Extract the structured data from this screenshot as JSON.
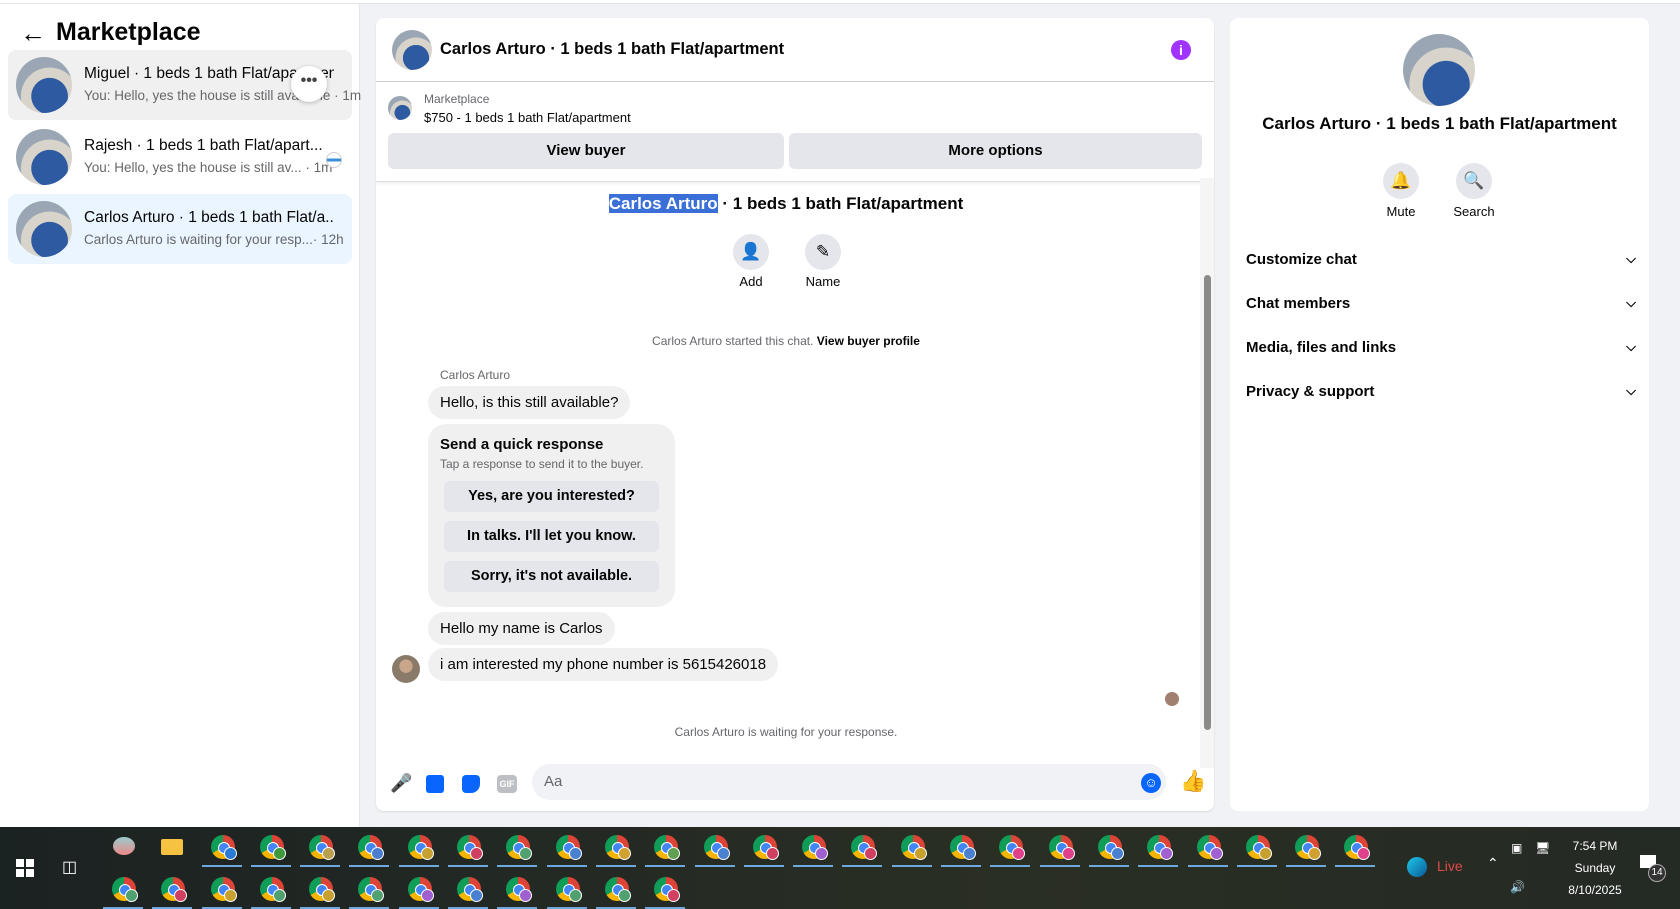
{
  "sidebar": {
    "title": "Marketplace",
    "conversations": [
      {
        "title": "Miguel · 1 beds 1 bath Flat/apartment",
        "snippet": "You: Hello, yes the house is still available",
        "time": "· 1m"
      },
      {
        "title": "Rajesh · 1 beds 1 bath Flat/apart...",
        "snippet": "You: Hello, yes the house is still av...",
        "time": "· 1m"
      },
      {
        "title": "Carlos Arturo · 1 beds 1 bath Flat/a...",
        "snippet": "Carlos Arturo is waiting for your resp...",
        "time": "· 12h"
      }
    ]
  },
  "chat": {
    "title": "Carlos Arturo · 1 beds 1 bath Flat/apartment",
    "listing": {
      "source": "Marketplace",
      "detail": "$750 - 1 beds 1 bath Flat/apartment"
    },
    "view_buyer": "View buyer",
    "more_options": "More options",
    "intro_name": "Carlos Arturo",
    "intro_rest": " · 1 beds 1 bath Flat/apartment",
    "add_label": "Add",
    "name_label": "Name",
    "started_text": "Carlos Arturo started this chat.",
    "view_profile": "View buyer profile",
    "sender": "Carlos Arturo",
    "messages": [
      "Hello, is this still available?",
      "Hello my name is Carlos",
      "i am interested my phone number is 5615426018"
    ],
    "quick": {
      "title": "Send a quick response",
      "subtitle": "Tap a response to send it to the buyer.",
      "options": [
        "Yes, are you interested?",
        "In talks. I'll let you know.",
        "Sorry, it's not available."
      ]
    },
    "waiting": "Carlos Arturo is waiting for your response.",
    "composer_placeholder": "Aa",
    "gif": "GIF"
  },
  "details": {
    "title": "Carlos Arturo · 1 beds 1 bath Flat/apartment",
    "mute": "Mute",
    "search": "Search",
    "sections": [
      "Customize chat",
      "Chat members",
      "Media, files and links",
      "Privacy & support"
    ]
  },
  "taskbar": {
    "live": "Live",
    "time": "7:54 PM",
    "day": "Sunday",
    "date": "8/10/2025",
    "notifications": "14",
    "row1_badges": [
      "#2a7bd5",
      "#3c9a3c",
      "#b8a050",
      "#4a7fd0",
      "#c8a030",
      "#d04060",
      "#50a070",
      "#4a80d0",
      "#d0a030",
      "#60a050",
      "#4a80d0",
      "#d04060",
      "#a060d0",
      "#d04060",
      "#c8a030",
      "#4a80d0",
      "#e0408a",
      "#e0408a",
      "#4a80d0",
      "#a060d0",
      "#a060d0",
      "#c8a030",
      "#d0a030",
      "#e0408a"
    ],
    "row2_badges": [
      "#50a070",
      "#d04060",
      "#c8a030",
      "#50a070",
      "#c8a030",
      "#50a070",
      "#a060d0",
      "#4a80d0",
      "#a060d0",
      "#50a070",
      "#50a070",
      "#d04060"
    ]
  }
}
